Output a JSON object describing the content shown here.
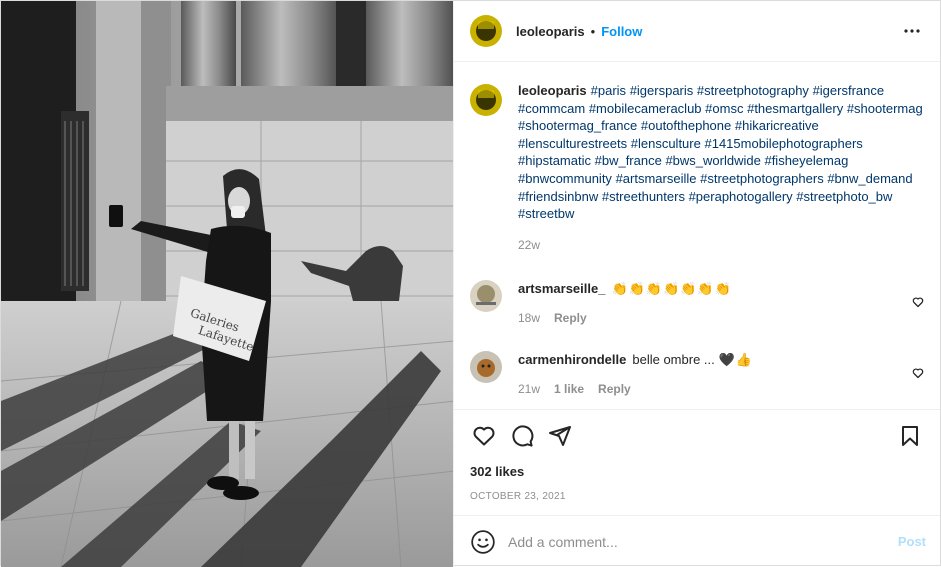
{
  "post": {
    "username": "leoleoparis",
    "dot": "•",
    "follow_label": "Follow",
    "more_icon": "ellipsis-icon"
  },
  "caption": {
    "username": "leoleoparis",
    "hashtags": [
      "#paris",
      "#igersparis",
      "#streetphotography",
      "#igersfrance",
      "#commcam",
      "#mobilecameraclub",
      "#omsc",
      "#thesmartgallery",
      "#shootermag",
      "#shootermag_france",
      "#outofthephone",
      "#hikaricreative",
      "#lensculturestreets",
      "#lensculture",
      "#1415mobilephotographers",
      "#hipstamatic",
      "#bw_france",
      "#bws_worldwide",
      "#fisheyelemag",
      "#bnwcommunity",
      "#artsmarseille",
      "#streetphotographers",
      "#bnw_demand",
      "#friendsinbnw",
      "#streethunters",
      "#peraphotogallery",
      "#streetphoto_bw",
      "#streetbw"
    ],
    "time": "22w"
  },
  "comments": [
    {
      "username": "artsmarseille_",
      "text": "",
      "emoji": "👏👏👏👏👏👏👏",
      "time": "18w",
      "likes": "",
      "reply_label": "Reply"
    },
    {
      "username": "carmenhirondelle",
      "text": "belle ombre ...",
      "emoji": "🖤👍",
      "time": "21w",
      "likes": "1 like",
      "reply_label": "Reply"
    }
  ],
  "actions": {
    "likes": "302 likes",
    "date": "OCTOBER 23, 2021"
  },
  "add_comment": {
    "placeholder": "Add a comment...",
    "post_label": "Post"
  },
  "colors": {
    "accent": "#0095f6",
    "hashtag": "#00376b",
    "muted": "#8e8e8e",
    "post_disabled": "#b2dffc"
  }
}
